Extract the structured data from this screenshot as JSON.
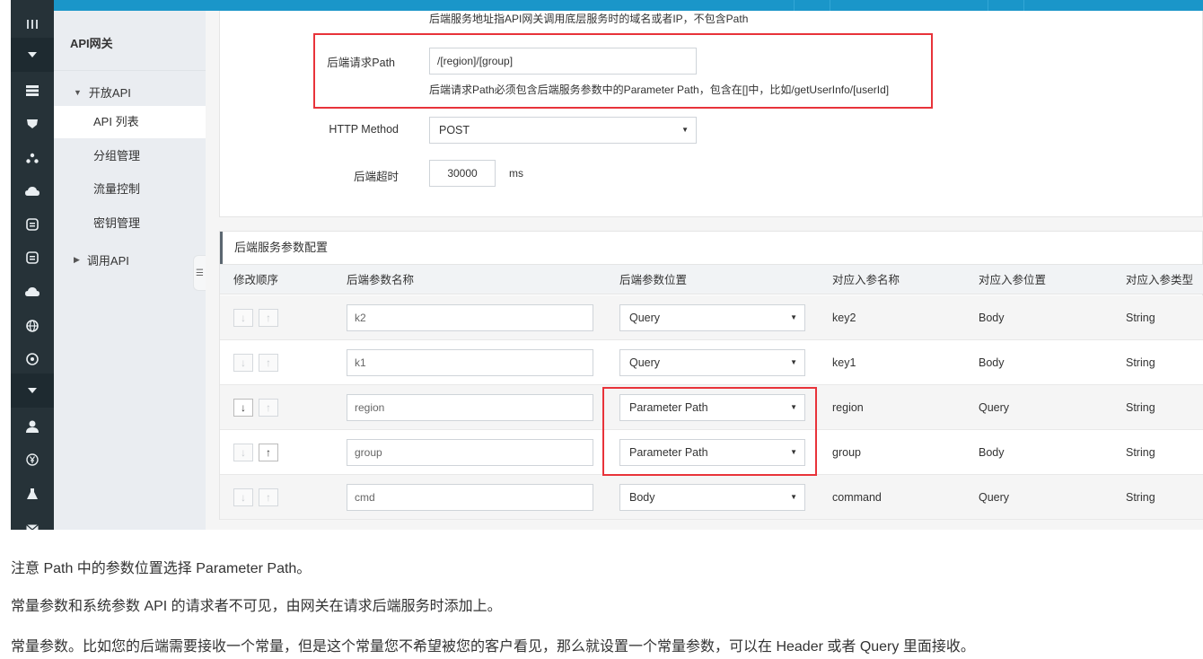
{
  "nav": {
    "title": "API网关",
    "group_open": "开放API",
    "items": [
      "API 列表",
      "分组管理",
      "流量控制",
      "密钥管理"
    ],
    "group_closed": "调用API"
  },
  "form": {
    "top_hint": "后端服务地址指API网关调用底层服务时的域名或者IP，不包含Path",
    "path_label": "后端请求Path",
    "path_value": "/[region]/[group]",
    "path_help": "后端请求Path必须包含后端服务参数中的Parameter Path，包含在[]中，比如/getUserInfo/[userId]",
    "method_label": "HTTP Method",
    "method_value": "POST",
    "timeout_label": "后端超时",
    "timeout_value": "30000",
    "timeout_unit": "ms"
  },
  "params": {
    "title": "后端服务参数配置",
    "headers": [
      "修改顺序",
      "后端参数名称",
      "后端参数位置",
      "对应入参名称",
      "对应入参位置",
      "对应入参类型"
    ],
    "down_arrow": "↓",
    "up_arrow": "↑",
    "rows": [
      {
        "name": "k2",
        "position": "Query",
        "in_name": "key2",
        "in_position": "Body",
        "in_type": "String"
      },
      {
        "name": "k1",
        "position": "Query",
        "in_name": "key1",
        "in_position": "Body",
        "in_type": "String"
      },
      {
        "name": "region",
        "position": "Parameter Path",
        "in_name": "region",
        "in_position": "Query",
        "in_type": "String"
      },
      {
        "name": "group",
        "position": "Parameter Path",
        "in_name": "group",
        "in_position": "Body",
        "in_type": "String"
      },
      {
        "name": "cmd",
        "position": "Body",
        "in_name": "command",
        "in_position": "Query",
        "in_type": "String"
      }
    ]
  },
  "doc": {
    "line1": "注意 Path 中的参数位置选择 Parameter Path。",
    "line2": "常量参数和系统参数 API 的请求者不可见，由网关在请求后端服务时添加上。",
    "line3": "常量参数。比如您的后端需要接收一个常量，但是这个常量您不希望被您的客户看见，那么就设置一个常量参数，可以在 Header 或者 Query 里面接收。"
  },
  "colors": {
    "accent": "#1a96c9",
    "highlight": "#e8333a",
    "rail": "#263238"
  }
}
